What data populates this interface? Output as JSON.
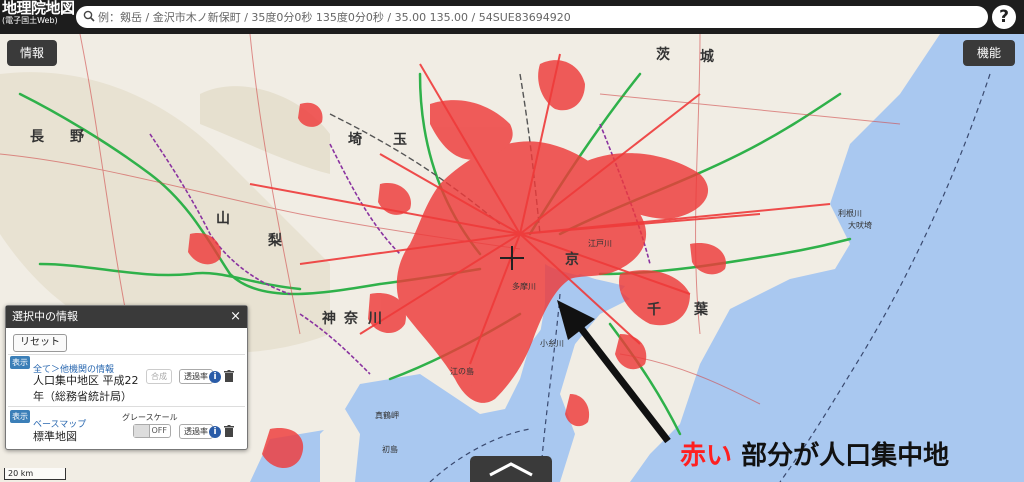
{
  "app": {
    "title": "地理院地図",
    "subtitle": "(電子国土Web)"
  },
  "search": {
    "placeholder": "例：剱岳 / 金沢市木ノ新保町 / 35度0分0秒 135度0分0秒 / 35.00 135.00 / 54SUE83694920"
  },
  "help_label": "?",
  "map_buttons": {
    "info": "情報",
    "functions": "機能"
  },
  "prefecture_labels": {
    "nagano_1": "長",
    "nagano_2": "野",
    "yamanashi_1": "山",
    "yamanashi_2": "梨",
    "saitama_1": "埼",
    "saitama_2": "玉",
    "ibaraki_1": "茨",
    "ibaraki_2": "城",
    "tokyo": "京",
    "kanagawa_1": "神",
    "kanagawa_2": "奈",
    "kanagawa_3": "川",
    "chiba_1": "千",
    "chiba_2": "葉"
  },
  "place_labels": {
    "tamagawa": "多摩川",
    "edogawa": "江戸川",
    "kobitogawa": "小糸川",
    "tone": "利根川",
    "taito": "大吠埼",
    "ayase": "江の島",
    "hiratsuka": "真鶴岬",
    "hatsushima": "初島"
  },
  "panel": {
    "title": "選択中の情報",
    "close": "×",
    "reset": "リセット",
    "layer1": {
      "tag": "表示",
      "breadcrumb": "全て＞他機関の情報",
      "name_line1": "人口集中地区 平成22",
      "name_line2": "年（総務省統計局）",
      "merge_button": "合成",
      "opacity_button": "透過率"
    },
    "layer2": {
      "tag": "表示",
      "breadcrumb": "ベースマップ",
      "name": "標準地図",
      "grayscale_label": "グレースケール",
      "toggle_label": "OFF",
      "opacity_button": "透過率"
    },
    "info_icon_label": "i"
  },
  "scale_bar": "20 km",
  "caption": {
    "red_part": "赤い",
    "black_part": " 部分が人口集中地"
  },
  "colors": {
    "header_bg": "#1d1d1d",
    "dense_area": "#ee3a3a",
    "sea": "#a9c8f0",
    "land": "#f1ede4",
    "caption_red": "#ff2020",
    "link_blue": "#2a68b0"
  }
}
